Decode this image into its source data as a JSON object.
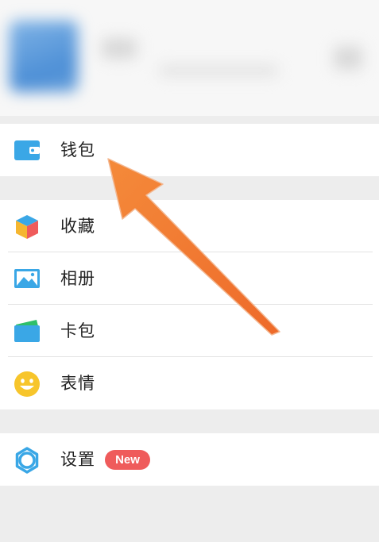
{
  "menu": {
    "wallet": {
      "label": "钱包",
      "icon": "wallet-icon"
    },
    "favorites": {
      "label": "收藏",
      "icon": "cube-icon"
    },
    "album": {
      "label": "相册",
      "icon": "image-icon"
    },
    "cards": {
      "label": "卡包",
      "icon": "card-icon"
    },
    "stickers": {
      "label": "表情",
      "icon": "smiley-icon"
    },
    "settings": {
      "label": "设置",
      "icon": "gear-icon",
      "badge": "New"
    }
  },
  "colors": {
    "accent": "#3aa7e6",
    "badge": "#ef5b5b",
    "arrow": "#f27a33"
  }
}
